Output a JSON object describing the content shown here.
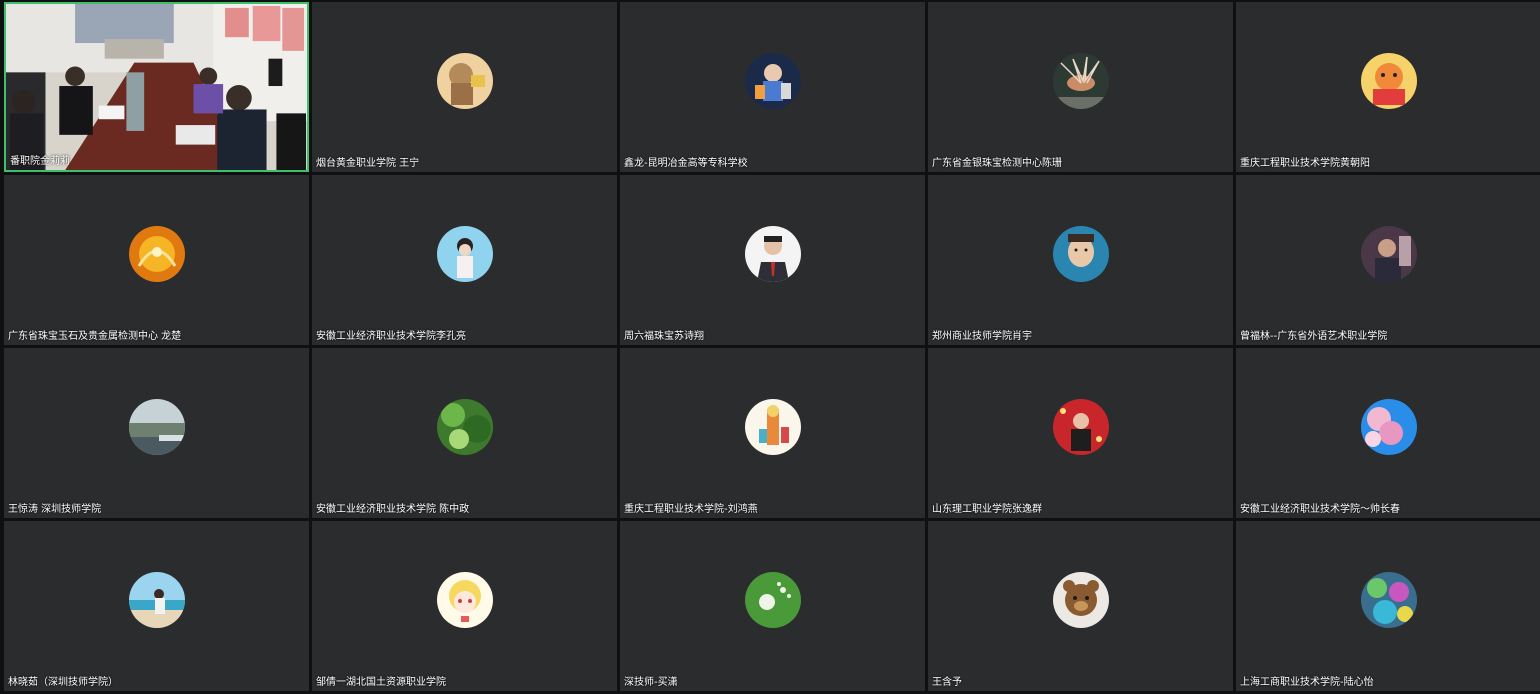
{
  "meeting": {
    "participants": [
      {
        "name": "番职院金莉莉",
        "avatar": "video-feed",
        "active": true
      },
      {
        "name": "烟台黄金职业学院 王宁",
        "avatar": "cartoon-girl-avatar"
      },
      {
        "name": "鑫龙-昆明冶金高等专科学校",
        "avatar": "cartoon-man-avatar"
      },
      {
        "name": "广东省金银珠宝检测中心陈珊",
        "avatar": "lionfish-avatar"
      },
      {
        "name": "重庆工程职业技术学院黄朝阳",
        "avatar": "cartoon-tiger-avatar"
      },
      {
        "name": "广东省珠宝玉石及贵金属检测中心 龙楚",
        "avatar": "phoenix-avatar"
      },
      {
        "name": "安徽工业经济职业技术学院李孔亮",
        "avatar": "child-photo-avatar"
      },
      {
        "name": "周六福珠宝苏诗翔",
        "avatar": "man-suit-avatar"
      },
      {
        "name": "郑州商业技师学院肖宇",
        "avatar": "child-portrait-avatar"
      },
      {
        "name": "曾福林--广东省外语艺术职业学院",
        "avatar": "man-photo-avatar"
      },
      {
        "name": "王惊涛 深圳技师学院",
        "avatar": "cityscape-avatar"
      },
      {
        "name": "安徽工业经济职业技术学院 陈中政",
        "avatar": "bamboo-avatar"
      },
      {
        "name": "重庆工程职业技术学院-刘鸿燕",
        "avatar": "illustration-avatar"
      },
      {
        "name": "山东理工职业学院张逸群",
        "avatar": "red-poster-avatar"
      },
      {
        "name": "安徽工业经济职业技术学院～帅长春",
        "avatar": "blossom-avatar"
      },
      {
        "name": "林晓茹（深圳技师学院）",
        "avatar": "beach-avatar"
      },
      {
        "name": "邹倩一湖北国土资源职业学院",
        "avatar": "anime-girl-avatar"
      },
      {
        "name": "深技师-买潇",
        "avatar": "dandelion-avatar"
      },
      {
        "name": "王含予",
        "avatar": "teddy-bear-avatar"
      },
      {
        "name": "上海工商职业技术学院-陆心怡",
        "avatar": "abstract-art-avatar"
      }
    ]
  },
  "colors": {
    "tile_bg": "#2b2c2e",
    "active_border": "#3fbf6a",
    "name_text": "#ffffff"
  }
}
